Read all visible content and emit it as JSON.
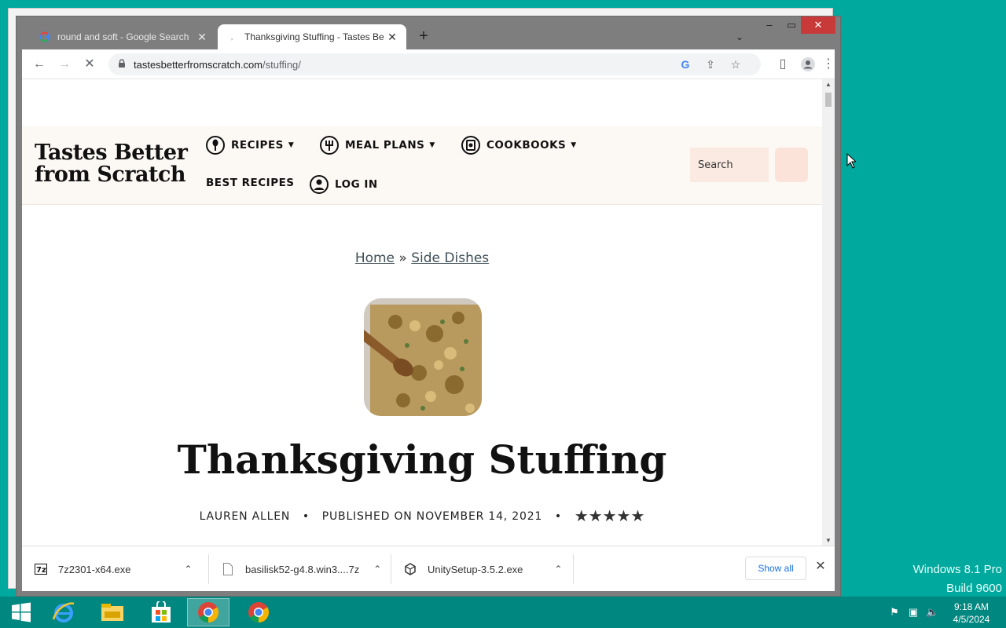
{
  "browser": {
    "tabs": [
      {
        "title": "round and soft - Google Search",
        "active": false
      },
      {
        "title": "Thanksgiving Stuffing - Tastes Be",
        "active": true
      }
    ],
    "new_tab_label": "+",
    "url_domain": "tastesbetterfromscratch.com",
    "url_path": "/stuffing/"
  },
  "site": {
    "logo_line1": "Tastes Better",
    "logo_line2": "from Scratch",
    "nav": [
      {
        "label": "RECIPES",
        "icon": "spoon-icon"
      },
      {
        "label": "MEAL PLANS",
        "icon": "plate-fork-icon"
      },
      {
        "label": "COOKBOOKS",
        "icon": "cookbook-icon"
      },
      {
        "label": "BEST RECIPES",
        "icon": ""
      },
      {
        "label": "LOG IN",
        "icon": "user-icon"
      }
    ],
    "search_placeholder": "Search"
  },
  "article": {
    "breadcrumb_home": "Home",
    "breadcrumb_sep": "»",
    "breadcrumb_category": "Side Dishes",
    "title": "Thanksgiving Stuffing",
    "author": "LAUREN ALLEN",
    "bullet": "•",
    "published": "PUBLISHED ON NOVEMBER 14, 2021",
    "stars": "★★★★★",
    "rating_value": 5
  },
  "downloads": {
    "items": [
      {
        "name": "7z2301-x64.exe",
        "icon": "7zip-icon"
      },
      {
        "name": "basilisk52-g4.8.win3....7z",
        "icon": "file-icon"
      },
      {
        "name": "UnitySetup-3.5.2.exe",
        "icon": "unity-icon"
      }
    ],
    "show_all": "Show all"
  },
  "os": {
    "watermark_line1": "Windows 8.1 Pro",
    "watermark_line2": "Build 9600",
    "time": "9:18 AM",
    "date": "4/5/2024"
  },
  "colors": {
    "desktop": "#00a99d",
    "taskbar": "#00877f",
    "header_bg": "#fcf9f4",
    "accent_card": "#a8d3d8"
  }
}
